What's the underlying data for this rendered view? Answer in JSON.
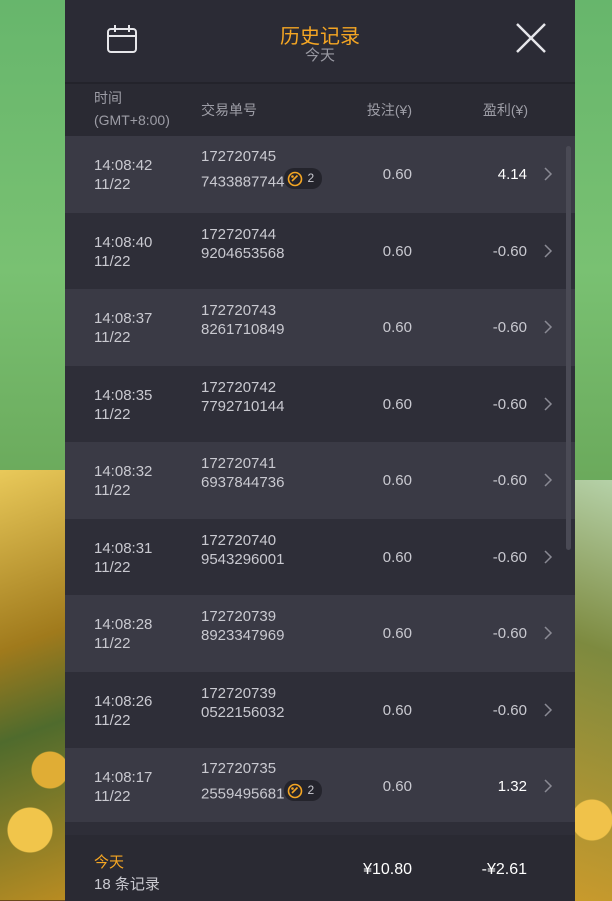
{
  "header": {
    "title": "历史记录",
    "subtitle": "今天"
  },
  "columns": {
    "time_label": "时间",
    "timezone": "(GMT+8:00)",
    "order": "交易单号",
    "bet": "投注(¥)",
    "profit": "盈利(¥)"
  },
  "rows": [
    {
      "time": "14:08:42",
      "date": "11/22",
      "order1": "172720745",
      "order2": "7433887744",
      "badge": "2",
      "bet": "0.60",
      "profit": "4.14",
      "positive": true
    },
    {
      "time": "14:08:40",
      "date": "11/22",
      "order1": "172720744",
      "order2": "9204653568",
      "badge": "",
      "bet": "0.60",
      "profit": "-0.60",
      "positive": false
    },
    {
      "time": "14:08:37",
      "date": "11/22",
      "order1": "172720743",
      "order2": "8261710849",
      "badge": "",
      "bet": "0.60",
      "profit": "-0.60",
      "positive": false
    },
    {
      "time": "14:08:35",
      "date": "11/22",
      "order1": "172720742",
      "order2": "7792710144",
      "badge": "",
      "bet": "0.60",
      "profit": "-0.60",
      "positive": false
    },
    {
      "time": "14:08:32",
      "date": "11/22",
      "order1": "172720741",
      "order2": "6937844736",
      "badge": "",
      "bet": "0.60",
      "profit": "-0.60",
      "positive": false
    },
    {
      "time": "14:08:31",
      "date": "11/22",
      "order1": "172720740",
      "order2": "9543296001",
      "badge": "",
      "bet": "0.60",
      "profit": "-0.60",
      "positive": false
    },
    {
      "time": "14:08:28",
      "date": "11/22",
      "order1": "172720739",
      "order2": "8923347969",
      "badge": "",
      "bet": "0.60",
      "profit": "-0.60",
      "positive": false
    },
    {
      "time": "14:08:26",
      "date": "11/22",
      "order1": "172720739",
      "order2": "0522156032",
      "badge": "",
      "bet": "0.60",
      "profit": "-0.60",
      "positive": false
    },
    {
      "time": "14:08:17",
      "date": "11/22",
      "order1": "172720735",
      "order2": "2559495681",
      "badge": "2",
      "bet": "0.60",
      "profit": "1.32",
      "positive": true
    }
  ],
  "footer": {
    "label": "今天",
    "count": "18 条记录",
    "total_bet": "¥10.80",
    "total_profit": "-¥2.61"
  },
  "colors": {
    "accent": "#f5a623",
    "panel": "#2e2e38",
    "row_alt": "#3a3a45"
  },
  "icons": {
    "calendar": "calendar-icon",
    "close": "close-icon",
    "chevron": "chevron-right-icon",
    "badge": "free-spin-icon"
  }
}
